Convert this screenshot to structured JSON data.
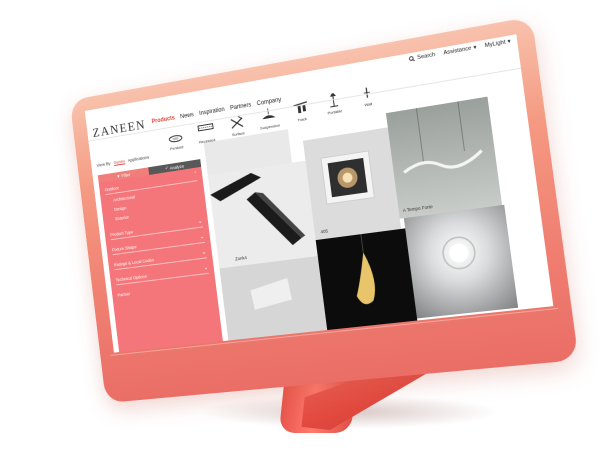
{
  "brand": {
    "logo_text": "ZANEEN"
  },
  "utility_nav": {
    "search": "Search",
    "assistance": "Assistance",
    "my_light": "MyLight"
  },
  "main_nav": [
    "Products",
    "News",
    "Inspiration",
    "Partners",
    "Company"
  ],
  "categories": [
    "Pendant",
    "Recessed",
    "Surface",
    "Suspension",
    "Track",
    "Portable",
    "Wall"
  ],
  "view_bar": {
    "label": "View By",
    "series": "Series",
    "applications": "Applications"
  },
  "sidebar": {
    "tab_filter": "Filter",
    "tab_analyze": "Analyze",
    "items": [
      {
        "label": "Outdoor",
        "level": 1
      },
      {
        "label": "Architectural",
        "level": 2
      },
      {
        "label": "Design",
        "level": 2
      },
      {
        "label": "Exterior",
        "level": 2
      },
      {
        "label": "Product Type",
        "level": 1
      },
      {
        "label": "Fixture Shape",
        "level": 1
      },
      {
        "label": "Ratings & Local Codes",
        "level": 1
      },
      {
        "label": "Technical Options",
        "level": 1
      },
      {
        "label": "Partner",
        "level": 1
      }
    ]
  },
  "grid": {
    "tiles": [
      {
        "caption": ""
      },
      {
        "caption": "Zonk4"
      },
      {
        "caption": "405"
      },
      {
        "caption": "A Tempo Forte"
      },
      {
        "caption": ""
      },
      {
        "caption": ""
      },
      {
        "caption": ""
      }
    ]
  },
  "colors": {
    "accent": "#e0453c",
    "sidebar": "#f4767a",
    "monitor": "#f08072"
  }
}
